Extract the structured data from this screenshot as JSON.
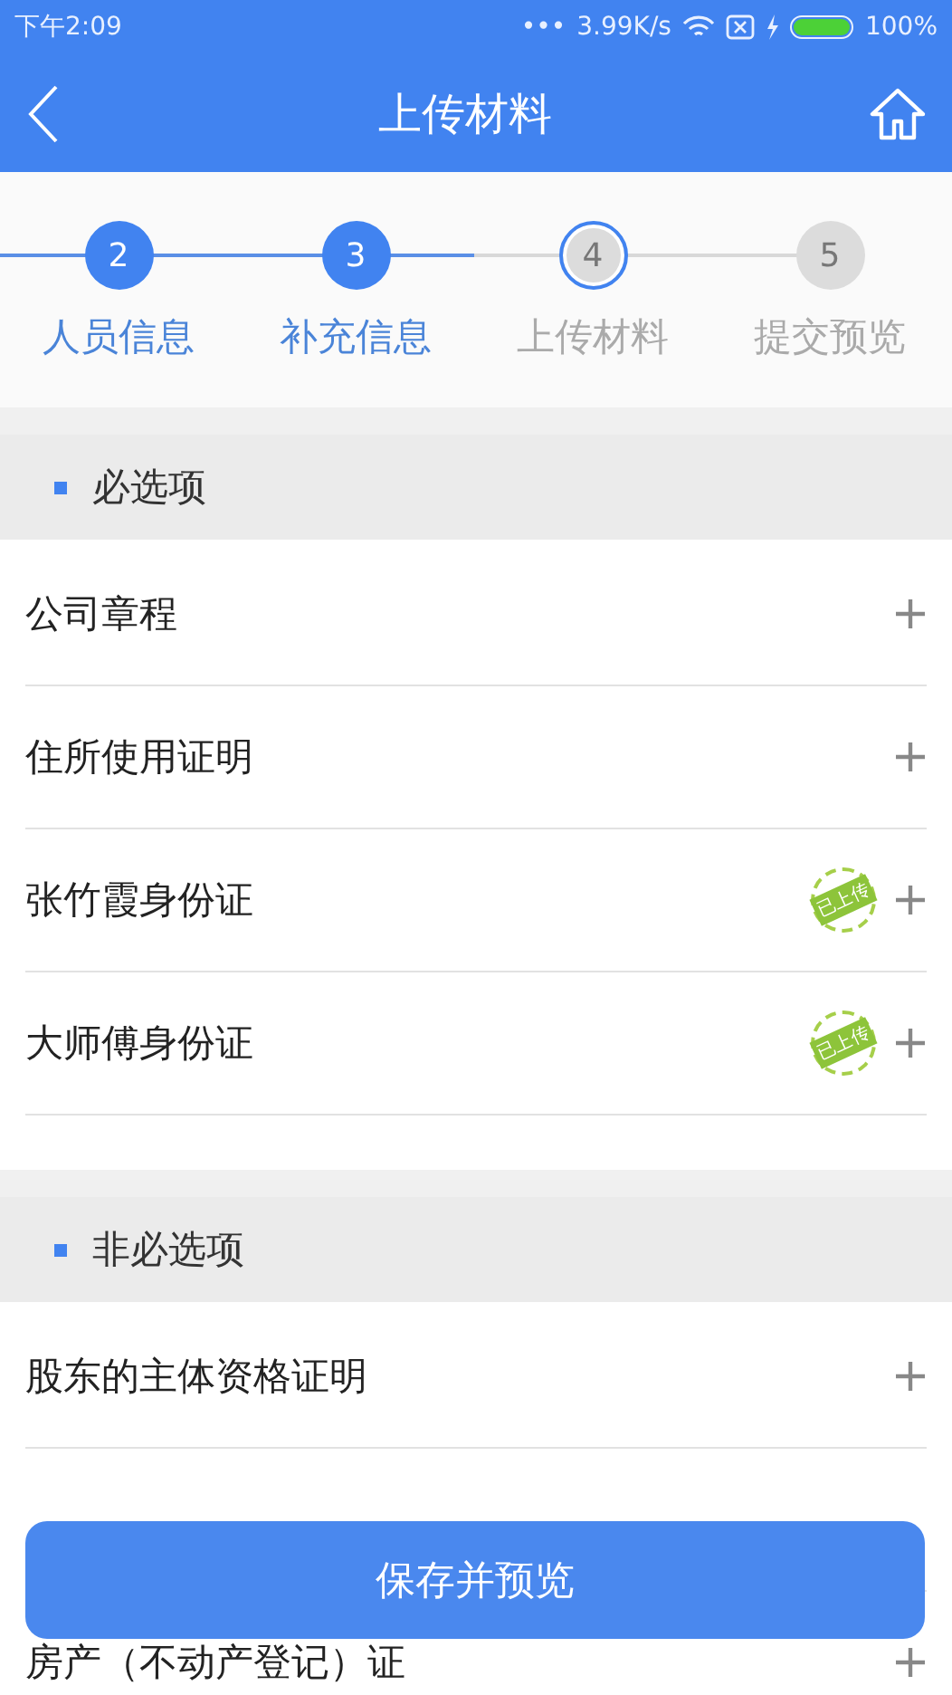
{
  "status_bar": {
    "time": "下午2:09",
    "dots": "•••",
    "speed": "3.99K/s",
    "battery": "100%"
  },
  "nav": {
    "title": "上传材料"
  },
  "steps": [
    {
      "number": "2",
      "label": "人员信息",
      "completed": true,
      "selected": false
    },
    {
      "number": "3",
      "label": "补充信息",
      "completed": true,
      "selected": false
    },
    {
      "number": "4",
      "label": "上传材料",
      "completed": false,
      "selected": true
    },
    {
      "number": "5",
      "label": "提交预览",
      "completed": false,
      "selected": false
    }
  ],
  "sections": [
    {
      "title": "必选项",
      "items": [
        {
          "name": "公司章程",
          "uploaded": false
        },
        {
          "name": "住所使用证明",
          "uploaded": false
        },
        {
          "name": "张竹霞身份证",
          "uploaded": true,
          "stamp": "已上传"
        },
        {
          "name": "大师傅身份证",
          "uploaded": true,
          "stamp": "已上传"
        }
      ]
    },
    {
      "title": "非必选项",
      "items": [
        {
          "name": "股东的主体资格证明",
          "uploaded": false
        },
        {
          "kind": "hidden"
        },
        {
          "name": "房产（不动产登记）证",
          "uploaded": false
        }
      ]
    }
  ],
  "save_button": "保存并预览"
}
